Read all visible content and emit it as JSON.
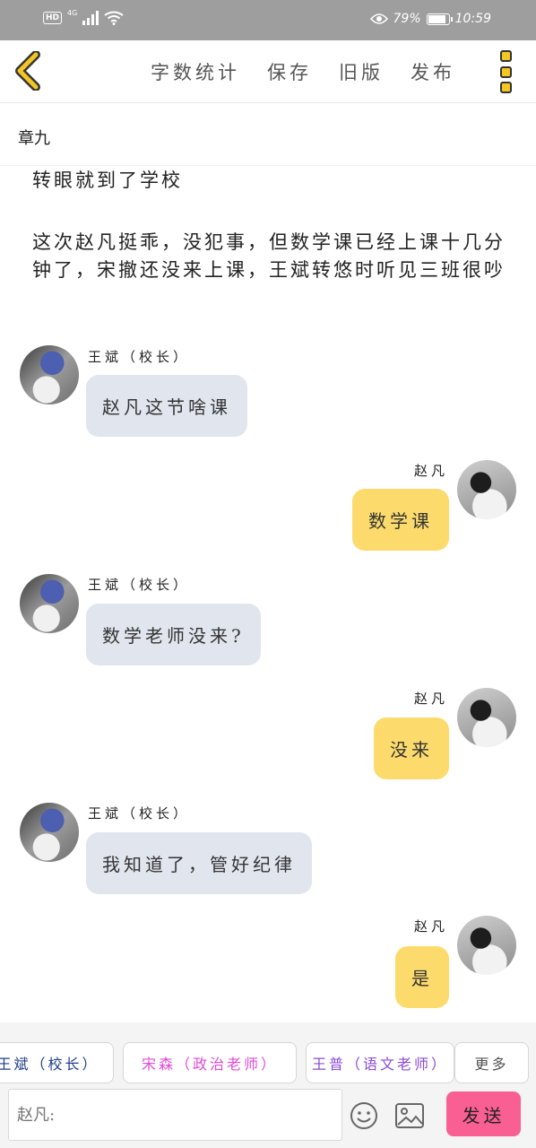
{
  "status_bar": {
    "network_label": "HD",
    "signal_label": "4G",
    "battery_text": "79%",
    "battery_level": 0.79,
    "time": "10:59"
  },
  "toolbar": {
    "items": [
      "字数统计",
      "保存",
      "旧版",
      "发布"
    ]
  },
  "chapter_title": "章九",
  "narration": [
    "转眼就到了学校",
    "这次赵凡挺乖，没犯事，但数学课已经上课十几分钟了，宋撤还没来上课，王斌转悠时听见三班很吵"
  ],
  "messages": [
    {
      "sender": "王斌（校长）",
      "text": "赵凡这节啥课",
      "side": "left"
    },
    {
      "sender": "赵凡",
      "text": "数学课",
      "side": "right"
    },
    {
      "sender": "王斌（校长）",
      "text": "数学老师没来?",
      "side": "left"
    },
    {
      "sender": "赵凡",
      "text": "没来",
      "side": "right"
    },
    {
      "sender": "王斌（校长）",
      "text": "我知道了，管好纪律",
      "side": "left"
    },
    {
      "sender": "赵凡",
      "text": "是",
      "side": "right"
    }
  ],
  "roles": [
    "王斌（校长）",
    "宋森（政治老师）",
    "王普（语文老师）"
  ],
  "roles_more": "更多",
  "input": {
    "placeholder": "赵凡:"
  },
  "send_label": "发送",
  "colors": {
    "left_bubble": "#e1e6ee",
    "right_bubble": "#fcdb6c",
    "send_button": "#fa5f93",
    "accent_yellow": "#f3c623"
  }
}
